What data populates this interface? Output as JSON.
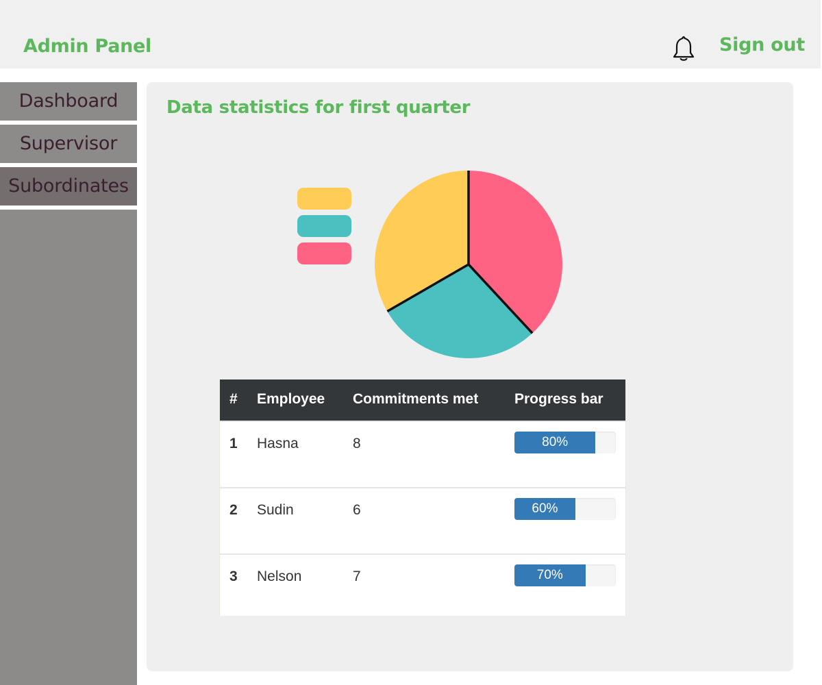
{
  "header": {
    "title": "Admin Panel",
    "notification_icon": "bell-icon",
    "sign_out_label": "Sign out"
  },
  "sidebar": {
    "items": [
      {
        "label": "Dashboard",
        "active": false
      },
      {
        "label": "Supervisor",
        "active": false
      },
      {
        "label": "Subordinates",
        "active": true
      }
    ]
  },
  "main": {
    "title": "Data statistics for first quarter"
  },
  "colors": {
    "accent": "#5cb85c",
    "table_header": "#33373a",
    "progress": "#337ab7"
  },
  "chart_data": {
    "type": "pie",
    "title": "",
    "legend_placement": "left",
    "slices": [
      {
        "label": "",
        "value": 8,
        "color": "#ff6384"
      },
      {
        "label": "",
        "value": 6,
        "color": "#4bc0c0"
      },
      {
        "label": "",
        "value": 7,
        "color": "#ffcd56"
      }
    ],
    "legend": [
      {
        "label": "",
        "color": "#ffcd56"
      },
      {
        "label": "",
        "color": "#4bc0c0"
      },
      {
        "label": "",
        "color": "#ff6384"
      }
    ]
  },
  "table": {
    "headers": [
      "#",
      "Employee",
      "Commitments met",
      "Progress bar"
    ],
    "rows": [
      {
        "num": "1",
        "employee": "Hasna",
        "commitments": "8",
        "progress": 80,
        "progress_label": "80%"
      },
      {
        "num": "2",
        "employee": "Sudin",
        "commitments": "6",
        "progress": 60,
        "progress_label": "60%"
      },
      {
        "num": "3",
        "employee": "Nelson",
        "commitments": "7",
        "progress": 70,
        "progress_label": "70%"
      }
    ]
  }
}
